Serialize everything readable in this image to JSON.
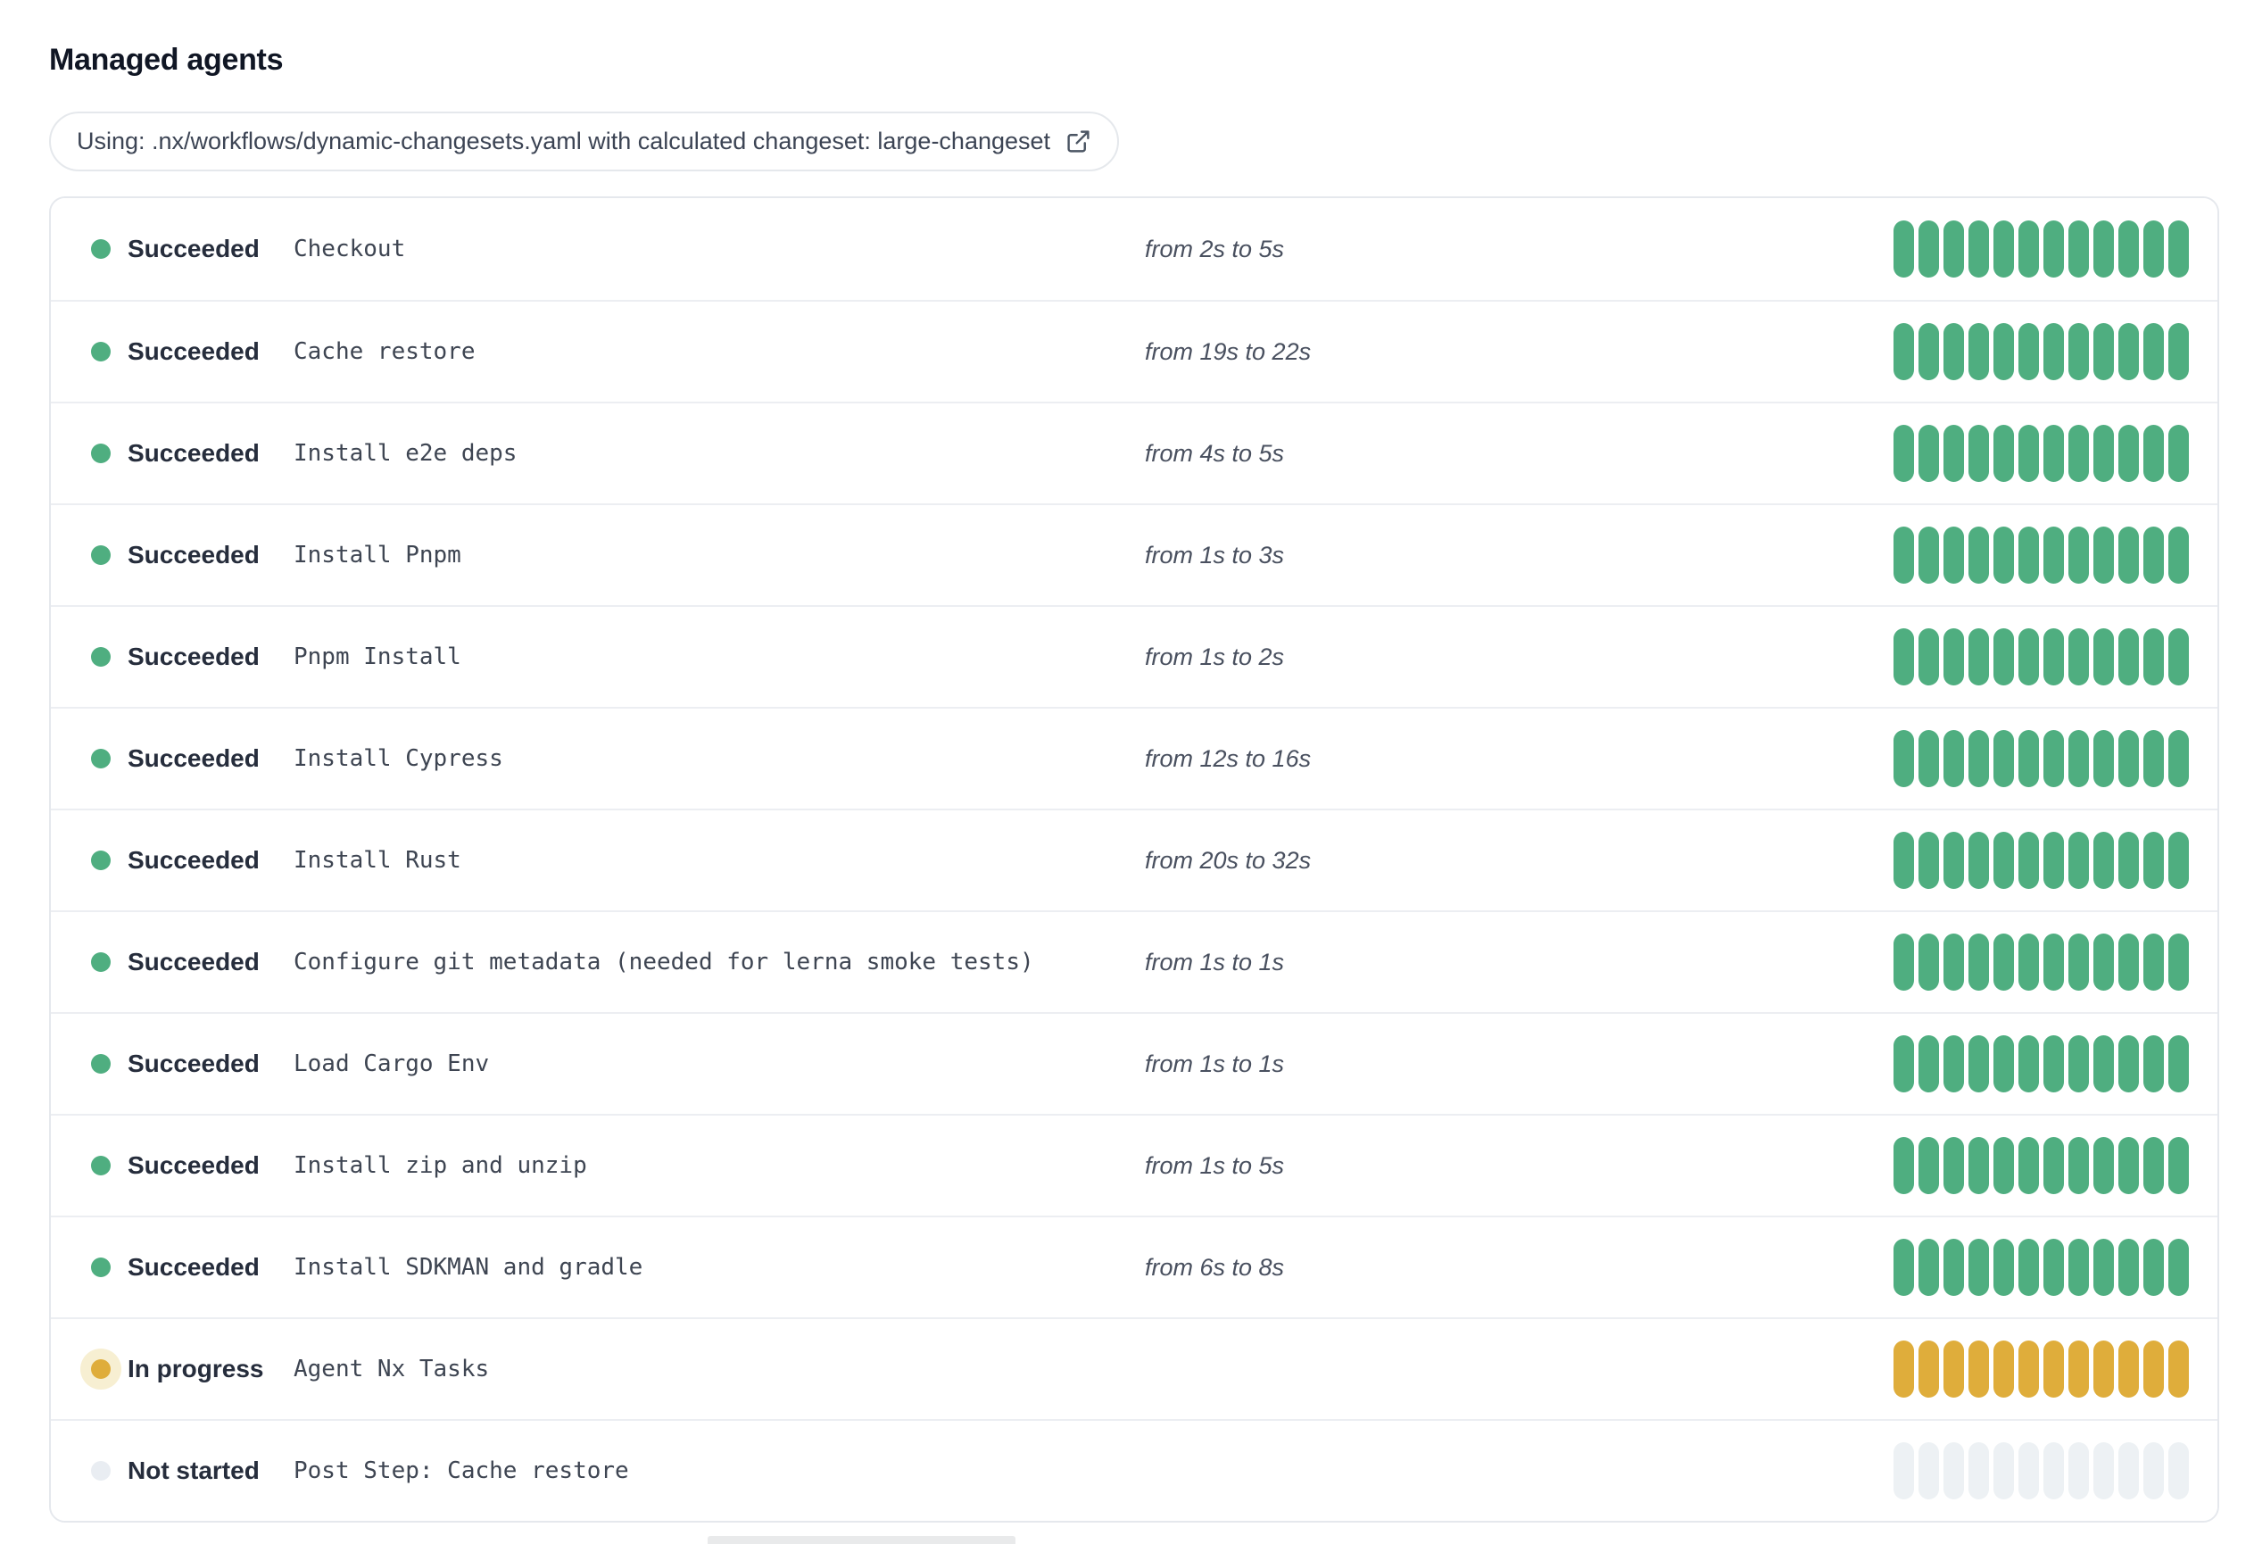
{
  "page": {
    "title": "Managed agents"
  },
  "banner": {
    "text": "Using: .nx/workflows/dynamic-changesets.yaml with calculated changeset: large-changeset",
    "icon": "external-link-icon"
  },
  "colors": {
    "succeeded": "#4fae80",
    "in_progress": "#dfad3b",
    "in_progress_halo": "#f7efd2",
    "not_started_dot": "#e9edf2",
    "not_started_segment": "#edf1f4",
    "card_border": "#e5e8ed",
    "row_divider": "#eceef2"
  },
  "segments_per_row": 12,
  "agents": [
    {
      "status": "succeeded",
      "status_label": "Succeeded",
      "step": "Checkout",
      "timing": "from 2s to 5s"
    },
    {
      "status": "succeeded",
      "status_label": "Succeeded",
      "step": "Cache restore",
      "timing": "from 19s to 22s"
    },
    {
      "status": "succeeded",
      "status_label": "Succeeded",
      "step": "Install e2e deps",
      "timing": "from 4s to 5s"
    },
    {
      "status": "succeeded",
      "status_label": "Succeeded",
      "step": "Install Pnpm",
      "timing": "from 1s to 3s"
    },
    {
      "status": "succeeded",
      "status_label": "Succeeded",
      "step": "Pnpm Install",
      "timing": "from 1s to 2s"
    },
    {
      "status": "succeeded",
      "status_label": "Succeeded",
      "step": "Install Cypress",
      "timing": "from 12s to 16s"
    },
    {
      "status": "succeeded",
      "status_label": "Succeeded",
      "step": "Install Rust",
      "timing": "from 20s to 32s"
    },
    {
      "status": "succeeded",
      "status_label": "Succeeded",
      "step": "Configure git metadata (needed for lerna smoke tests)",
      "timing": "from 1s to 1s"
    },
    {
      "status": "succeeded",
      "status_label": "Succeeded",
      "step": "Load Cargo Env",
      "timing": "from 1s to 1s"
    },
    {
      "status": "succeeded",
      "status_label": "Succeeded",
      "step": "Install zip and unzip",
      "timing": "from 1s to 5s"
    },
    {
      "status": "succeeded",
      "status_label": "Succeeded",
      "step": "Install SDKMAN and gradle",
      "timing": "from 6s to 8s"
    },
    {
      "status": "in_progress",
      "status_label": "In progress",
      "step": "Agent Nx Tasks",
      "timing": ""
    },
    {
      "status": "not_started",
      "status_label": "Not started",
      "step": "Post Step: Cache restore",
      "timing": ""
    }
  ]
}
